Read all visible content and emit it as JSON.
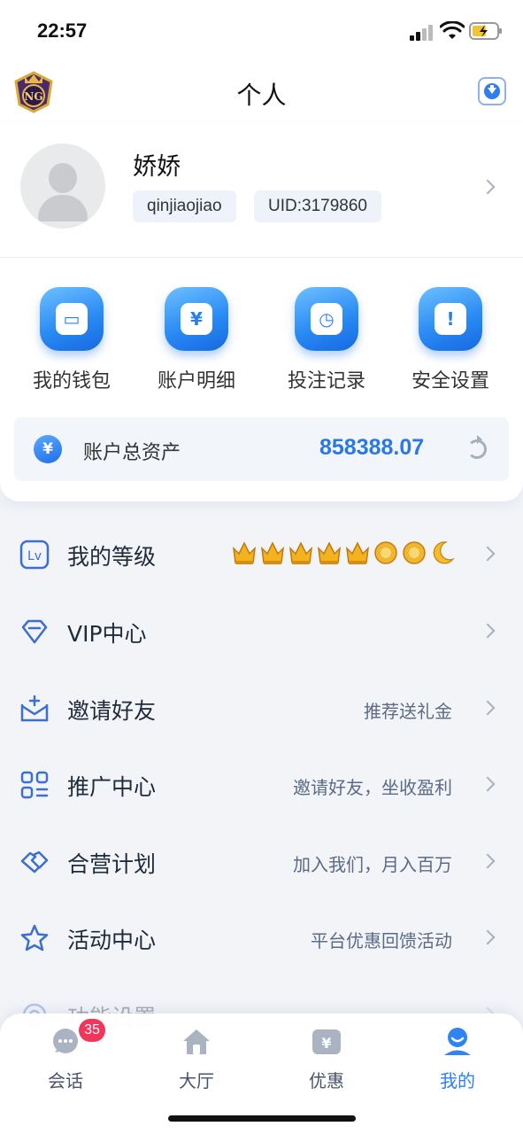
{
  "status_bar": {
    "time": "22:57"
  },
  "header": {
    "title": "个人"
  },
  "profile": {
    "nickname": "娇娇",
    "username": "qinjiaojiao",
    "uid": "UID:3179860"
  },
  "quick_actions": [
    {
      "label": "我的钱包",
      "icon": "wallet-icon"
    },
    {
      "label": "账户明细",
      "icon": "yen-icon"
    },
    {
      "label": "投注记录",
      "icon": "bet-record-icon"
    },
    {
      "label": "安全设置",
      "icon": "shield-icon"
    }
  ],
  "assets": {
    "label": "账户总资产",
    "value": "858388.07",
    "currency_symbol": "¥"
  },
  "menu": [
    {
      "label": "我的等级",
      "sub": "",
      "icon": "level-icon"
    },
    {
      "label": "VIP中心",
      "sub": "",
      "icon": "diamond-icon"
    },
    {
      "label": "邀请好友",
      "sub": "推荐送礼金",
      "icon": "invite-mail-icon"
    },
    {
      "label": "推广中心",
      "sub": "邀请好友，坐收盈利",
      "icon": "grid-icon"
    },
    {
      "label": "合营计划",
      "sub": "加入我们，月入百万",
      "icon": "handshake-icon"
    },
    {
      "label": "活动中心",
      "sub": "平台优惠回馈活动",
      "icon": "star-icon"
    },
    {
      "label": "功能设置",
      "sub": "",
      "icon": "settings-icon"
    }
  ],
  "level": {
    "crowns": 5,
    "suns": 2,
    "moons": 1
  },
  "tabbar": [
    {
      "label": "会话",
      "icon": "chat-icon",
      "badge": "35"
    },
    {
      "label": "大厅",
      "icon": "home-icon"
    },
    {
      "label": "优惠",
      "icon": "coupon-icon"
    },
    {
      "label": "我的",
      "icon": "user-icon",
      "active": true
    }
  ],
  "colors": {
    "accent": "#2a7ff0",
    "badge": "#f2355b",
    "asset_value": "#2a78e6"
  }
}
